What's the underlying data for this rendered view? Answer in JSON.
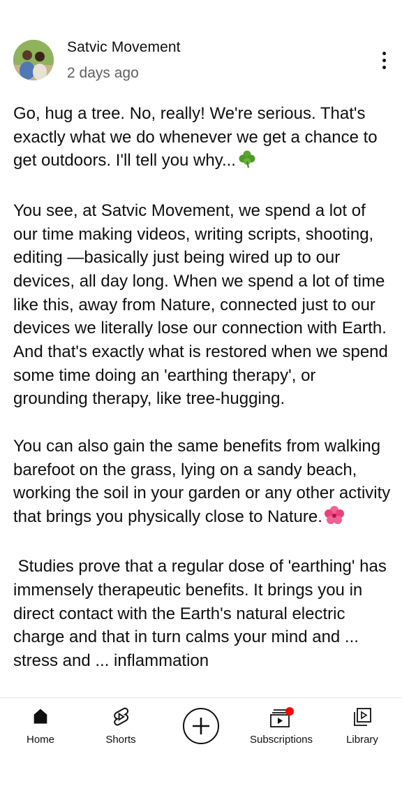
{
  "post": {
    "channel_name": "Satvic Movement",
    "time_ago": "2 days ago",
    "paragraphs": [
      "Go, hug a tree. No, really! We're serious. That's exactly what we do whenever we get a chance to get outdoors. I'll tell you why...",
      "You see, at Satvic Movement, we spend a lot of our time making videos, writing scripts, shooting, editing —basically just being wired up to our devices, all day long. When we spend a lot of time like this, away from Nature, connected just to our devices we literally lose our connection with Earth. And that's exactly what is restored when we spend some time doing an 'earthing therapy', or grounding therapy, like tree-hugging.",
      "You can also gain the same benefits from walking barefoot on the grass, lying on a sandy beach, working the soil in your garden or any other activity that brings you physically close to Nature.",
      " Studies prove that a regular dose of 'earthing' has immensely therapeutic benefits. It brings you in direct contact with the Earth's natural electric charge and that in turn calms your mind and ... stress and ... inflammation"
    ],
    "emoji_1": "clover-emoji",
    "emoji_2": "hibiscus-emoji"
  },
  "nav": {
    "home": "Home",
    "shorts": "Shorts",
    "create": "create-icon",
    "subscriptions": "Subscriptions",
    "library": "Library"
  },
  "colors": {
    "notification": "#ff0000",
    "secondary_text": "#606060"
  }
}
